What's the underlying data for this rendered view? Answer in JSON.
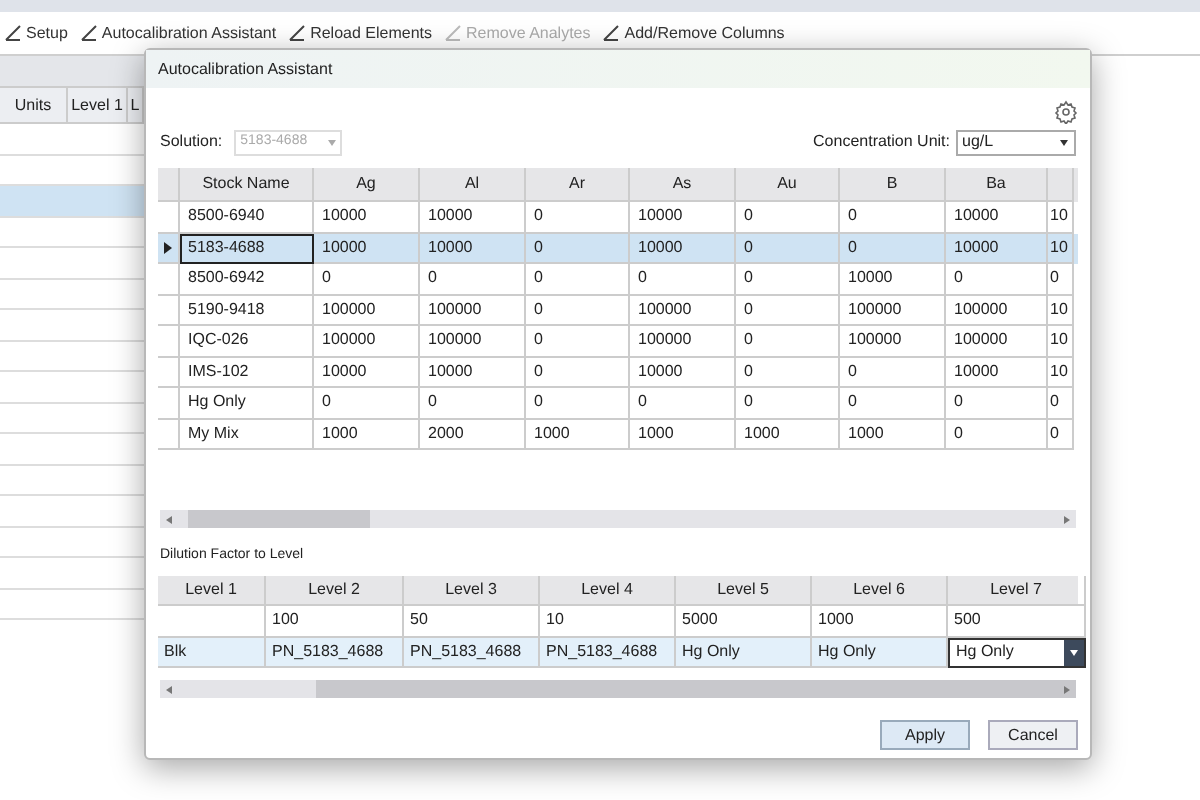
{
  "toolbar": [
    {
      "label": "Setup",
      "disabled": false
    },
    {
      "label": "Autocalibration Assistant",
      "disabled": false
    },
    {
      "label": "Reload Elements",
      "disabled": false
    },
    {
      "label": "Remove Analytes",
      "disabled": true
    },
    {
      "label": "Add/Remove Columns",
      "disabled": false
    }
  ],
  "background_table": {
    "columns": [
      "Units",
      "Level 1",
      "L"
    ],
    "rows": [
      {
        "selected": false
      },
      {
        "selected": false
      },
      {
        "selected": true
      },
      {
        "selected": false
      },
      {
        "selected": false
      },
      {
        "selected": false
      },
      {
        "selected": false
      },
      {
        "selected": false
      },
      {
        "selected": false
      },
      {
        "selected": false
      },
      {
        "selected": false
      },
      {
        "selected": false
      },
      {
        "selected": false
      },
      {
        "selected": false
      },
      {
        "selected": false
      },
      {
        "selected": false
      }
    ]
  },
  "dialog": {
    "title": "Autocalibration Assistant",
    "solution": {
      "label": "Solution:",
      "value": "5183-4688",
      "disabled": true
    },
    "concentration_unit": {
      "label": "Concentration Unit:",
      "value": "ug/L"
    },
    "stock_table": {
      "columns": [
        "Stock Name",
        "Ag",
        "Al",
        "Ar",
        "As",
        "Au",
        "B",
        "Ba",
        ""
      ],
      "rows": [
        {
          "selected": false,
          "cells": [
            "8500-6940",
            "10000",
            "10000",
            "0",
            "10000",
            "0",
            "0",
            "10000",
            "10"
          ]
        },
        {
          "selected": true,
          "cells": [
            "5183-4688",
            "10000",
            "10000",
            "0",
            "10000",
            "0",
            "0",
            "10000",
            "10"
          ]
        },
        {
          "selected": false,
          "cells": [
            "8500-6942",
            "0",
            "0",
            "0",
            "0",
            "0",
            "10000",
            "0",
            "0"
          ]
        },
        {
          "selected": false,
          "cells": [
            "5190-9418",
            "100000",
            "100000",
            "0",
            "100000",
            "0",
            "100000",
            "100000",
            "10"
          ]
        },
        {
          "selected": false,
          "cells": [
            "IQC-026",
            "100000",
            "100000",
            "0",
            "100000",
            "0",
            "100000",
            "100000",
            "10"
          ]
        },
        {
          "selected": false,
          "cells": [
            "IMS-102",
            "10000",
            "10000",
            "0",
            "10000",
            "0",
            "0",
            "10000",
            "10"
          ]
        },
        {
          "selected": false,
          "cells": [
            "Hg Only",
            "0",
            "0",
            "0",
            "0",
            "0",
            "0",
            "0",
            "0"
          ]
        },
        {
          "selected": false,
          "cells": [
            "My Mix",
            "1000",
            "2000",
            "1000",
            "1000",
            "1000",
            "1000",
            "0",
            "0"
          ]
        }
      ]
    },
    "dilution_label": "Dilution Factor to Level",
    "level_table": {
      "columns": [
        "Level 1",
        "Level 2",
        "Level 3",
        "Level 4",
        "Level 5",
        "Level 6",
        "Level 7"
      ],
      "rows": [
        {
          "selected": false,
          "cells": [
            "",
            "100",
            "50",
            "10",
            "5000",
            "1000",
            "500"
          ]
        },
        {
          "selected": true,
          "cells": [
            "Blk",
            "PN_5183_4688",
            "PN_5183_4688",
            "PN_5183_4688",
            "Hg Only",
            "Hg Only",
            "Hg Only"
          ]
        }
      ]
    },
    "buttons": [
      "Apply",
      "Cancel"
    ]
  }
}
